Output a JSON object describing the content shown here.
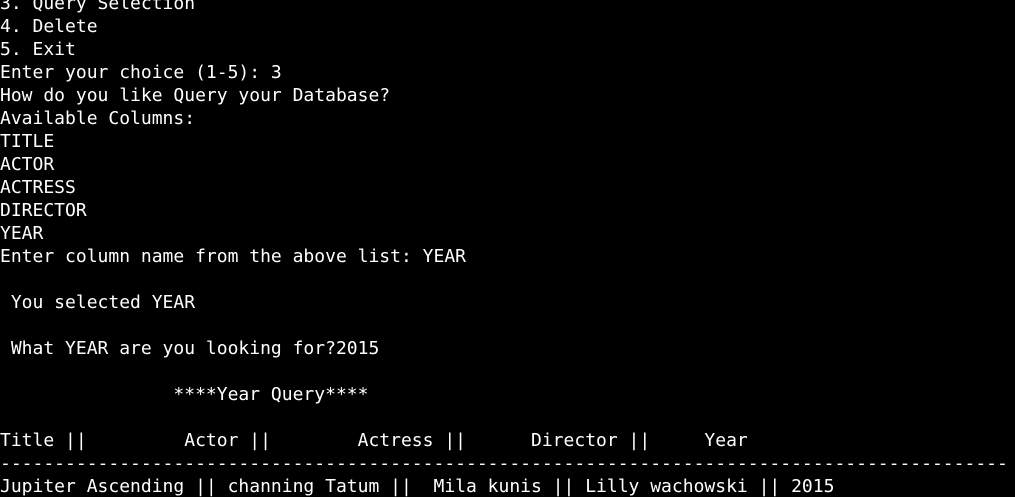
{
  "terminal": {
    "background": "#000000",
    "foreground": "#ffffff",
    "lines": [
      "3. Query Selection",
      "4. Delete",
      "5. Exit",
      "Enter your choice (1-5): 3",
      "How do you like Query your Database?",
      "Available Columns:",
      "TITLE",
      "ACTOR",
      "ACTRESS",
      "DIRECTOR",
      "YEAR",
      "Enter column name from the above list: YEAR",
      "",
      " You selected YEAR",
      "",
      " What YEAR are you looking for?2015",
      "",
      "                ****Year Query****",
      "",
      "Title ||         Actor ||        Actress ||      Director ||     Year",
      "---------------------------------------------------------------------------------------------",
      "Jupiter Ascending || channing Tatum ||  Mila kunis || Lilly wachowski || 2015"
    ]
  }
}
